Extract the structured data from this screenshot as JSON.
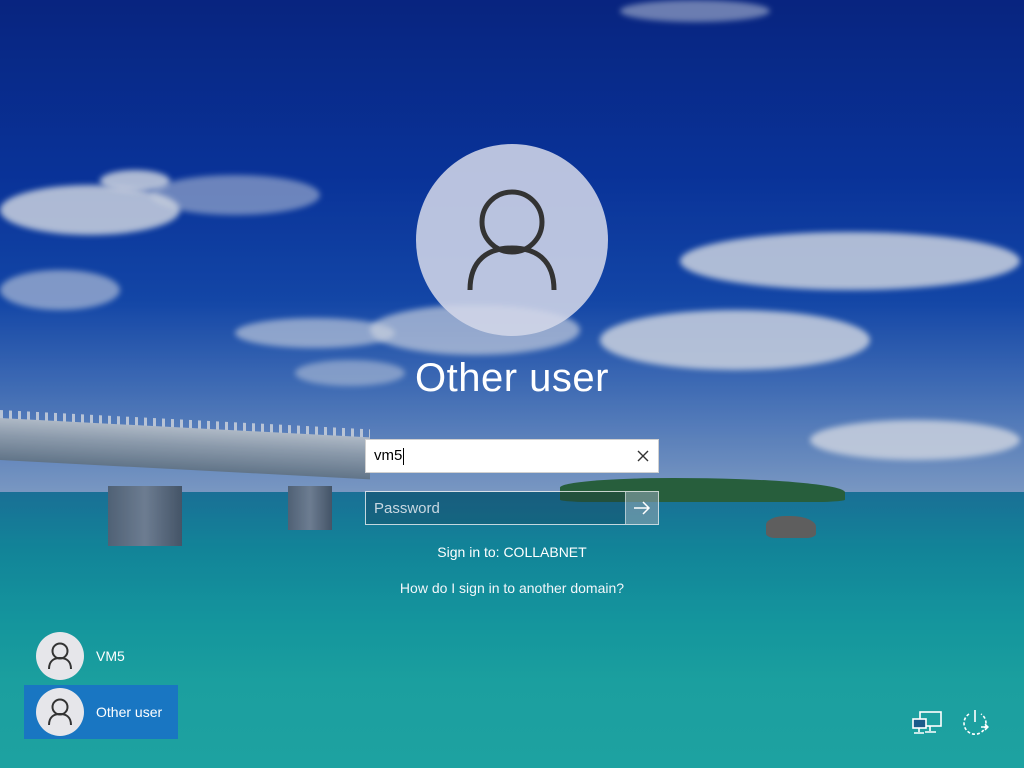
{
  "main": {
    "title": "Other user",
    "username": {
      "value": "vm5"
    },
    "password": {
      "placeholder": "Password"
    },
    "sign_in_to": "Sign in to: COLLABNET",
    "domain_help_link": "How do I sign in to another domain?"
  },
  "user_list": [
    {
      "name": "VM5",
      "selected": false
    },
    {
      "name": "Other user",
      "selected": true
    }
  ],
  "icons": {
    "avatar": "person-icon",
    "clear": "close-icon",
    "submit": "arrow-right-icon",
    "network": "network-icon",
    "power": "power-icon"
  },
  "colors": {
    "selected_user_bg": "#1976c2",
    "avatar_bg": "#d2d6e8"
  }
}
